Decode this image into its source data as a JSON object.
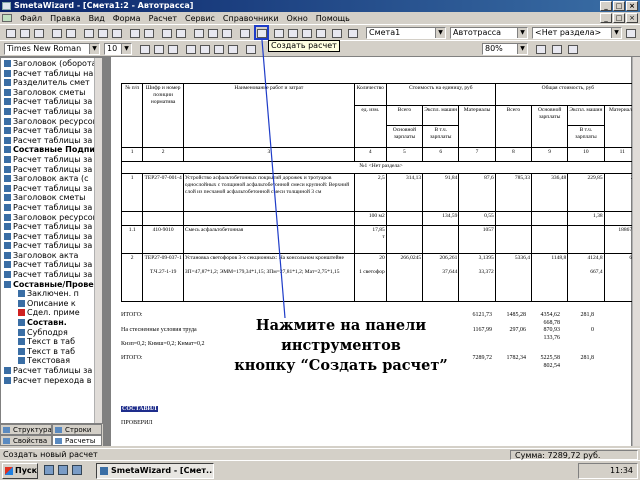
{
  "window": {
    "title": "SmetaWizard - [Смета1:2 - Автотрасса]"
  },
  "menu": [
    "Файл",
    "Правка",
    "Вид",
    "Форма",
    "Расчет",
    "Сервис",
    "Справочники",
    "Окно",
    "Помощь"
  ],
  "toolbar": {
    "tooltip": "Создать расчет",
    "estimate_select": "Смета1",
    "object_select": "Автотрасса",
    "section_select": "<Нет раздела>",
    "font_select": "Times New Roman",
    "size_select": "10",
    "zoom_select": "80%"
  },
  "tree": {
    "items": [
      {
        "label": "Заголовок (оборота)",
        "style": ""
      },
      {
        "label": "Расчет таблицы на",
        "style": ""
      },
      {
        "label": "Разделитель смет",
        "style": ""
      },
      {
        "label": "Заголовок сметы",
        "style": ""
      },
      {
        "label": "Расчет таблицы за",
        "style": ""
      },
      {
        "label": "Расчет таблицы за",
        "style": ""
      },
      {
        "label": "Заголовок ресурсов",
        "style": ""
      },
      {
        "label": "Расчет таблицы за",
        "style": ""
      },
      {
        "label": "Расчет таблицы за",
        "style": ""
      },
      {
        "label": "Составные Подписи",
        "style": "bold"
      },
      {
        "label": "Расчет таблицы за",
        "style": ""
      },
      {
        "label": "Расчет таблицы за",
        "style": ""
      },
      {
        "label": "Заголовок акта (с",
        "style": ""
      },
      {
        "label": "Расчет таблицы за",
        "style": ""
      },
      {
        "label": "Заголовок сметы",
        "style": ""
      },
      {
        "label": "Расчет таблицы за",
        "style": ""
      },
      {
        "label": "Заголовок ресурсов",
        "style": ""
      },
      {
        "label": "Расчет таблицы за",
        "style": ""
      },
      {
        "label": "Расчет таблицы за",
        "style": ""
      },
      {
        "label": "Расчет таблицы за",
        "style": ""
      },
      {
        "label": "Заголовок акта",
        "style": ""
      },
      {
        "label": "Расчет таблицы за",
        "style": ""
      },
      {
        "label": "Расчет таблицы за",
        "style": ""
      },
      {
        "label": "Составные/Прове",
        "style": "bold"
      },
      {
        "label": "Заключен. п",
        "style": ""
      },
      {
        "label": "Описание к",
        "style": ""
      },
      {
        "label": "Сдел. приме",
        "style": "redx"
      },
      {
        "label": "Составн.",
        "style": "bold"
      },
      {
        "label": "Субподря",
        "style": ""
      },
      {
        "label": "Текст в таб",
        "style": ""
      },
      {
        "label": "Текст в таб",
        "style": ""
      },
      {
        "label": "Текстовая",
        "style": ""
      },
      {
        "label": "Расчет таблицы за",
        "style": ""
      },
      {
        "label": "Расчет перехода в",
        "style": ""
      }
    ]
  },
  "tabs": [
    "Структура",
    "Строки",
    "Свойства",
    "Расчеты"
  ],
  "table": {
    "header": {
      "c1": "№ п/п",
      "c2": "Шифр и номер позиции норматива",
      "c3": "Наименование работ и затрат",
      "c4": "Количество",
      "c4u": "ед. изм.",
      "unit_cost": "Стоимость на единицу, руб",
      "total_cost": "Общая стоимость, руб",
      "all": "Всего",
      "exp_machines": "Экспл. машин",
      "materials": "Материалы",
      "base_wage": "Основной зарплаты",
      "incl_wage": "В т.ч. зарплаты",
      "base_wage2": "Основной зарплаты",
      "exp2": "Экспл. машин",
      "incl2": "В т.ч. зарплаты",
      "mat2": "Материалы"
    },
    "nums": [
      "1",
      "2",
      "3",
      "4",
      "5",
      "6",
      "7",
      "8",
      "9",
      "10",
      "11"
    ],
    "section": "№1 <Нет раздела>",
    "rows": [
      {
        "n": "1",
        "code": "ТЕР27-07-001-4",
        "name": "Устройство асфальтобетонных покрытий дорожек и тротуаров однослойных с толщиной асфальтобетонной смеси крупной: Верхний слой из песчаной асфальтобетонной смеси толщиной 3 см",
        "qty": "2,5",
        "qty2": "100 м2",
        "a": "314,13",
        "b": "91,84",
        "c": "87,6",
        "d": "785,33",
        "e": "336,48",
        "f": "229,85",
        "g": "219",
        "b2": "134,59",
        "c2": "0,55",
        "f2": "1,38"
      },
      {
        "n": "1.1",
        "code": "410-9010",
        "name": "Смесь асфальтобетонная",
        "qty": "17,85",
        "qty2": "т",
        "a": "",
        "b": "",
        "c": "1057",
        "d": "",
        "e": "",
        "f": "",
        "g": "18867,45"
      },
      {
        "n": "2",
        "code": "ТЕР27-09-037-1",
        "code2": "Т.Ч.27-1-19",
        "name": "Установка светофоров 3-х секционных: На консольном кронштейне",
        "name2": "ЗП=47,87*1,2; ЭММ=179,34*1,15; ЗПм=27,81*1,2; Мат=2,75*1,15",
        "qty": "20",
        "qty2": "1 светофор",
        "a": "266,0245",
        "b": "206,261",
        "c": "3,1395",
        "d": "5336,4",
        "e": "1148,8",
        "f": "4124,8",
        "g": "62,8",
        "b2": "37,644",
        "c2": "33,372",
        "f2": "667,4"
      }
    ],
    "totals": [
      {
        "label": "ИТОГО:",
        "v1": "6121,73",
        "v2": "1485,28",
        "v3": "4354,62",
        "v4": "281,8",
        "v5": "668,78"
      },
      {
        "label": "На стесненные условия труда",
        "v1": "1167,99",
        "v2": "297,06",
        "v3": "870,93",
        "v4": "0",
        "v5": "133,76"
      },
      {
        "label": "Кнзп=0,2; Кнмш=0,2; Кнмат=0,2",
        "v1": "",
        "v2": "",
        "v3": "",
        "v4": "",
        "v5": ""
      },
      {
        "label": "ИТОГО:",
        "v1": "7289,72",
        "v2": "1782,34",
        "v3": "5225,58",
        "v4": "281,8",
        "v5": "802,54"
      }
    ],
    "signed": "СОСТАВИЛ",
    "checked": "ПРОВЕРИЛ"
  },
  "caption": {
    "line1": "Нажмите на панели инструментов",
    "line2": "кнопку “Создать расчет”"
  },
  "status": {
    "left": "Создать новый расчет",
    "right": "Сумма: 7289,72 руб."
  },
  "taskbar": {
    "start": "Пуск",
    "app": "SmetaWizard - [Смет...",
    "clock": "11:34"
  },
  "colors": {
    "title": "#0a246a",
    "highlight": "#1e3cc8",
    "arrow": "#1e3cc8"
  }
}
